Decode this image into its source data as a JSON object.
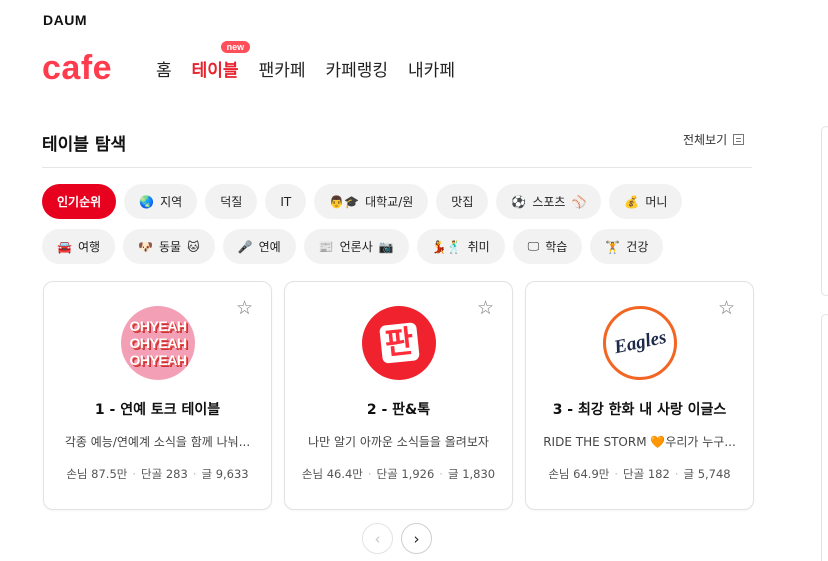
{
  "header": {
    "brand": "DAUM",
    "logo": "cafe",
    "nav": [
      {
        "label": "홈",
        "active": false
      },
      {
        "label": "테이블",
        "active": true,
        "badge": "new"
      },
      {
        "label": "팬카페",
        "active": false
      },
      {
        "label": "카페랭킹",
        "active": false
      },
      {
        "label": "내카페",
        "active": false
      }
    ]
  },
  "section": {
    "title": "테이블 탐색",
    "view_all": "전체보기",
    "view_all_icon": "list-icon"
  },
  "chips": {
    "row1": [
      {
        "label": "인기순위",
        "emoji": "",
        "active": true
      },
      {
        "label": "지역",
        "emoji": "🌏",
        "active": false
      },
      {
        "label": "덕질",
        "emoji": "",
        "active": false
      },
      {
        "label": "IT",
        "emoji": "",
        "active": false
      },
      {
        "label": "대학교/원",
        "emoji": "👨🎓",
        "active": false
      },
      {
        "label": "맛집",
        "emoji": "",
        "active": false
      },
      {
        "label": "스포츠",
        "emoji": "⚽",
        "emoji_after": "⚾",
        "active": false
      },
      {
        "label": "머니",
        "emoji": "💰",
        "active": false
      }
    ],
    "row2": [
      {
        "label": "여행",
        "emoji": "🚘",
        "active": false
      },
      {
        "label": "동물",
        "emoji": "🐶",
        "emoji_after": "🐱",
        "active": false
      },
      {
        "label": "연예",
        "emoji": "🎤",
        "active": false
      },
      {
        "label": "언론사",
        "emoji": "📰",
        "emoji_after": "📷",
        "active": false
      },
      {
        "label": "취미",
        "emoji": "💃🕺",
        "active": false
      },
      {
        "label": "학습",
        "emoji": "🖵",
        "active": false
      },
      {
        "label": "건강",
        "emoji": "🏋",
        "active": false
      }
    ]
  },
  "cards": [
    {
      "rank": "1",
      "title": "연예 토크 테이블",
      "title_full": "1 - 연예 토크 테이블",
      "description": "각종 예능/연예계 소식을 함께 나눠...",
      "guests_label": "손님",
      "guests": "87.5만",
      "regulars_label": "단골",
      "regulars": "283",
      "posts_label": "글",
      "posts": "9,633",
      "thumb_text": [
        "OHYEAH",
        "OHYEAH",
        "OHYEAH"
      ]
    },
    {
      "rank": "2",
      "title": "판&톡",
      "title_full": "2 - 판&톡",
      "description": "나만 알기 아까운 소식들을 올려보자",
      "guests_label": "손님",
      "guests": "46.4만",
      "regulars_label": "단골",
      "regulars": "1,926",
      "posts_label": "글",
      "posts": "1,830",
      "thumb_text": [
        "판"
      ]
    },
    {
      "rank": "3",
      "title": "최강 한화 내 사랑 이글스",
      "title_full": "3 - 최강 한화 내 사랑 이글스",
      "description": "RIDE THE STORM 🧡우리가 누구...",
      "guests_label": "손님",
      "guests": "64.9만",
      "regulars_label": "단골",
      "regulars": "182",
      "posts_label": "글",
      "posts": "5,748",
      "thumb_text": [
        "Eagles"
      ]
    }
  ],
  "pager": {
    "prev": "‹",
    "next": "›"
  },
  "colors": {
    "accent": "#e8001f",
    "logo": "#ff3b4e",
    "chip_bg": "#f2f2f2"
  }
}
